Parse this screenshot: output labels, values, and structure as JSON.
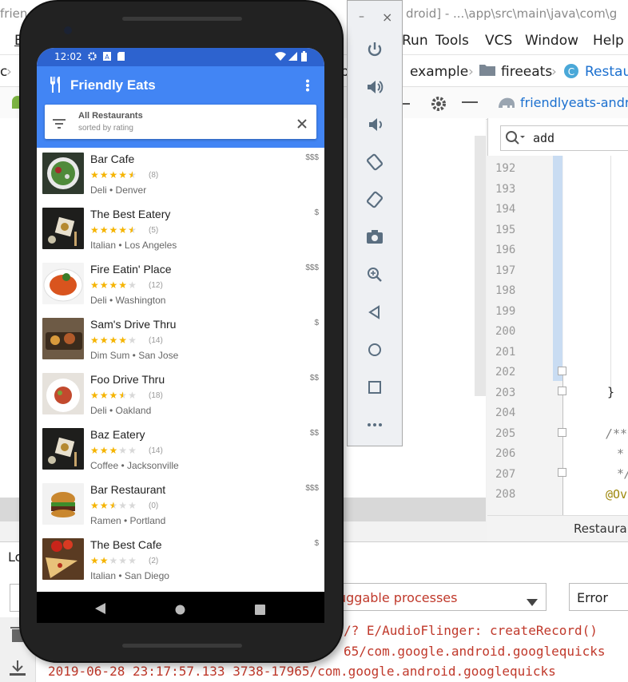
{
  "ide": {
    "title_fragments": [
      "frien",
      "droid] - ...\\app\\src\\main\\java\\com\\g"
    ],
    "menu": [
      "E",
      "Run",
      "Tools",
      "VCS",
      "Window",
      "Help"
    ],
    "breadcrumb": [
      "c",
      "b",
      "example",
      "fireeats",
      "Restau"
    ],
    "project_tab": "friendlyeats-andr",
    "search_value": "add",
    "line_numbers": [
      "192",
      "193",
      "194",
      "195",
      "196",
      "197",
      "198",
      "199",
      "200",
      "201",
      "202",
      "203",
      "204",
      "205",
      "206",
      "207",
      "208"
    ],
    "code_lines": [
      {
        "line": "203",
        "text": "}"
      },
      {
        "line": "205",
        "text": "/**"
      },
      {
        "line": "206",
        "text": "*"
      },
      {
        "line": "207",
        "text": "*/"
      },
      {
        "line": "208",
        "text": "@Ov"
      }
    ],
    "editor_tab": "Restaura",
    "logcat": {
      "left_label": "Lo",
      "process_filter": "uggable processes",
      "level_filter": "Error",
      "lines": [
        "/? E/AudioFlinger: createRecord()",
        "65/com.google.android.googlequicks",
        "2019-06-28 23:17:57.133 3738-17965/com.google.android.googlequicks"
      ]
    },
    "colors": {
      "log_error": "#c0392b",
      "link_blue": "#1a6fcf"
    }
  },
  "emulator_toolbar": {
    "window_buttons": [
      "–",
      "×"
    ],
    "buttons": [
      "power-icon",
      "volume-up-icon",
      "volume-down-icon",
      "rotate-left-icon",
      "rotate-right-icon",
      "camera-icon",
      "zoom-icon",
      "back-icon",
      "home-icon",
      "overview-icon",
      "more-icon"
    ]
  },
  "phone": {
    "status": {
      "time": "12:02"
    },
    "app": {
      "title": "Friendly Eats",
      "filter_title": "All Restaurants",
      "filter_subtitle": "sorted by rating",
      "colors": {
        "primary": "#4285f4",
        "status": "#2d63cf",
        "star": "#f5b400"
      }
    },
    "restaurants": [
      {
        "name": "Bar Cafe",
        "rating": 4.5,
        "stars": "★★★★★",
        "count": "(8)",
        "meta": "Deli • Denver",
        "price": "$$$",
        "img": "salad"
      },
      {
        "name": "The Best Eatery",
        "rating": 4.5,
        "stars": "★★★★★",
        "count": "(5)",
        "meta": "Italian • Los Angeles",
        "price": "$",
        "img": "dark"
      },
      {
        "name": "Fire Eatin' Place",
        "rating": 4.0,
        "stars": "★★★★★",
        "count": "(12)",
        "meta": "Deli • Washington",
        "price": "$$$",
        "img": "pasta"
      },
      {
        "name": "Sam's Drive Thru",
        "rating": 4.0,
        "stars": "★★★★★",
        "count": "(14)",
        "meta": "Dim Sum • San Jose",
        "price": "$",
        "img": "board"
      },
      {
        "name": "Foo Drive Thru",
        "rating": 3.5,
        "stars": "★★★★★",
        "count": "(18)",
        "meta": "Deli • Oakland",
        "price": "$$",
        "img": "plate"
      },
      {
        "name": "Baz Eatery",
        "rating": 3.0,
        "stars": "★★★★★",
        "count": "(14)",
        "meta": "Coffee • Jacksonville",
        "price": "$$",
        "img": "dark"
      },
      {
        "name": "Bar Restaurant",
        "rating": 2.5,
        "stars": "★★★★★",
        "count": "(0)",
        "meta": "Ramen • Portland",
        "price": "$$$",
        "img": "burger"
      },
      {
        "name": "The Best Cafe",
        "rating": 2.0,
        "stars": "★★★★★",
        "count": "(2)",
        "meta": "Italian • San Diego",
        "price": "$",
        "img": "pizza"
      }
    ]
  }
}
